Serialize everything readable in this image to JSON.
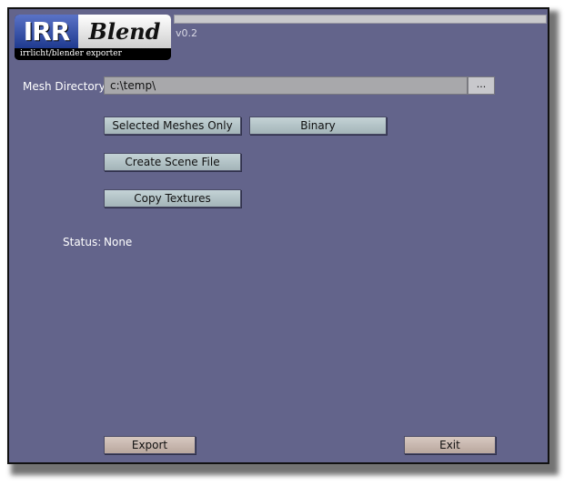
{
  "logo": {
    "irr": "IRR",
    "blend": "Blend",
    "subtitle": "irrlicht/blender exporter"
  },
  "version": "v0.2",
  "mesh_directory": {
    "label": "Mesh Directory",
    "value": "c:\\temp\\",
    "browse_label": "..."
  },
  "options": {
    "selected_meshes_only": "Selected Meshes Only",
    "binary": "Binary",
    "create_scene_file": "Create Scene File",
    "copy_textures": "Copy Textures"
  },
  "status": {
    "label": "Status:",
    "value": "None"
  },
  "actions": {
    "export": "Export",
    "exit": "Exit"
  },
  "colors": {
    "background": "#63648b",
    "option_button": "#b4c4c7",
    "action_button": "#c8b8b0"
  }
}
